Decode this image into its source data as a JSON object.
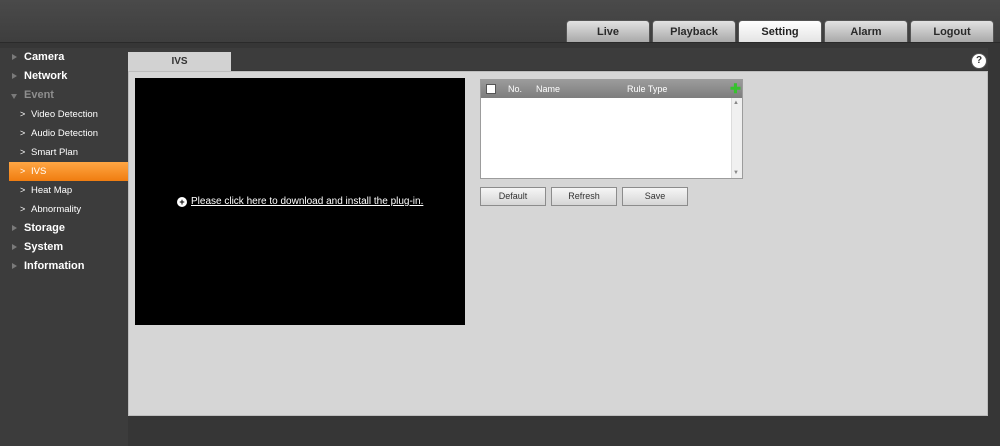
{
  "top_tabs": [
    {
      "label": "Live"
    },
    {
      "label": "Playback"
    },
    {
      "label": "Setting"
    },
    {
      "label": "Alarm"
    },
    {
      "label": "Logout"
    }
  ],
  "sidebar": {
    "items": [
      {
        "label": "Camera"
      },
      {
        "label": "Network"
      },
      {
        "label": "Event"
      },
      {
        "label": "Video Detection"
      },
      {
        "label": "Audio Detection"
      },
      {
        "label": "Smart Plan"
      },
      {
        "label": "IVS"
      },
      {
        "label": "Heat Map"
      },
      {
        "label": "Abnormality"
      },
      {
        "label": "Storage"
      },
      {
        "label": "System"
      },
      {
        "label": "Information"
      }
    ]
  },
  "page_tab": "IVS",
  "help_glyph": "?",
  "video": {
    "plugin_text": "Please click here to download and install the plug-in."
  },
  "rule_table": {
    "headers": {
      "no": "No.",
      "name": "Name",
      "rule_type": "Rule Type"
    }
  },
  "buttons": {
    "default": "Default",
    "refresh": "Refresh",
    "save": "Save"
  },
  "colors": {
    "active_nav": "#f58a1e",
    "add_icon": "#36c22e"
  }
}
